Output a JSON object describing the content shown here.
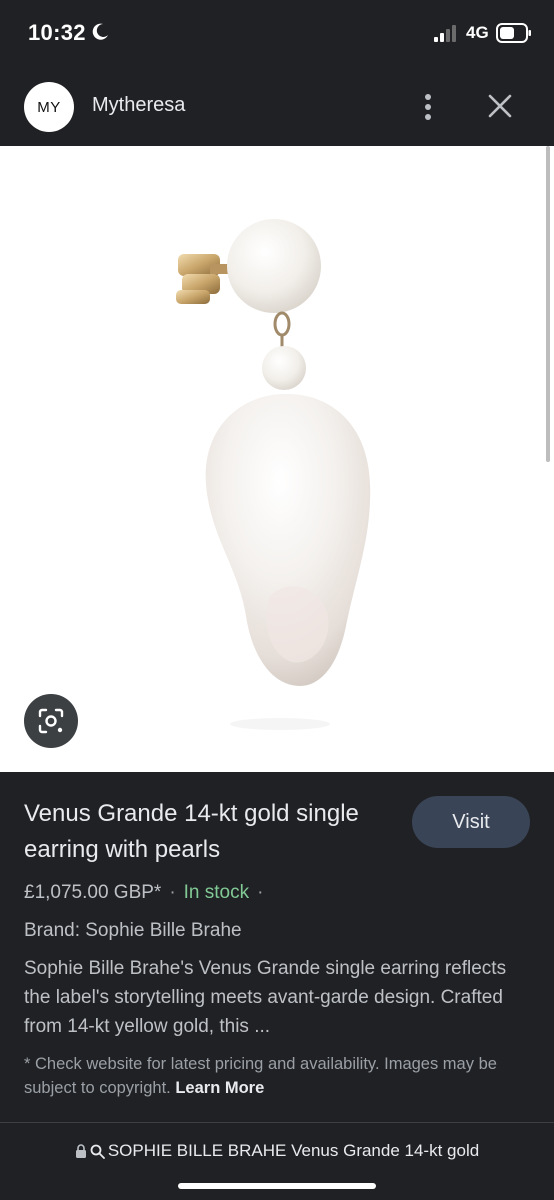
{
  "status_bar": {
    "time": "10:32",
    "network": "4G"
  },
  "header": {
    "avatar_text": "MY",
    "site_name": "Mytheresa"
  },
  "product": {
    "title": "Venus Grande 14-kt gold single earring with pearls",
    "visit_label": "Visit",
    "price": "£1,075.00 GBP*",
    "stock": "In stock",
    "brand": "Brand: Sophie Bille Brahe",
    "description": "Sophie Bille Brahe's Venus Grande single earring reflects the label's storytelling meets avant-garde design. Crafted from 14-kt yellow gold, this ...",
    "disclaimer": "* Check website for latest pricing and availability. Images may be subject to copyright.",
    "learn_more": "Learn More"
  },
  "bottom_bar": {
    "url_text": "SOPHIE BILLE BRAHE Venus Grande 14-kt gold"
  },
  "icons": [
    "moon-icon",
    "signal-icon",
    "battery-icon",
    "more-vert-icon",
    "close-icon",
    "lens-icon",
    "lock-icon",
    "search-icon"
  ],
  "colors": {
    "background": "#202124",
    "visit_button": "#394457",
    "in_stock": "#81c995"
  }
}
